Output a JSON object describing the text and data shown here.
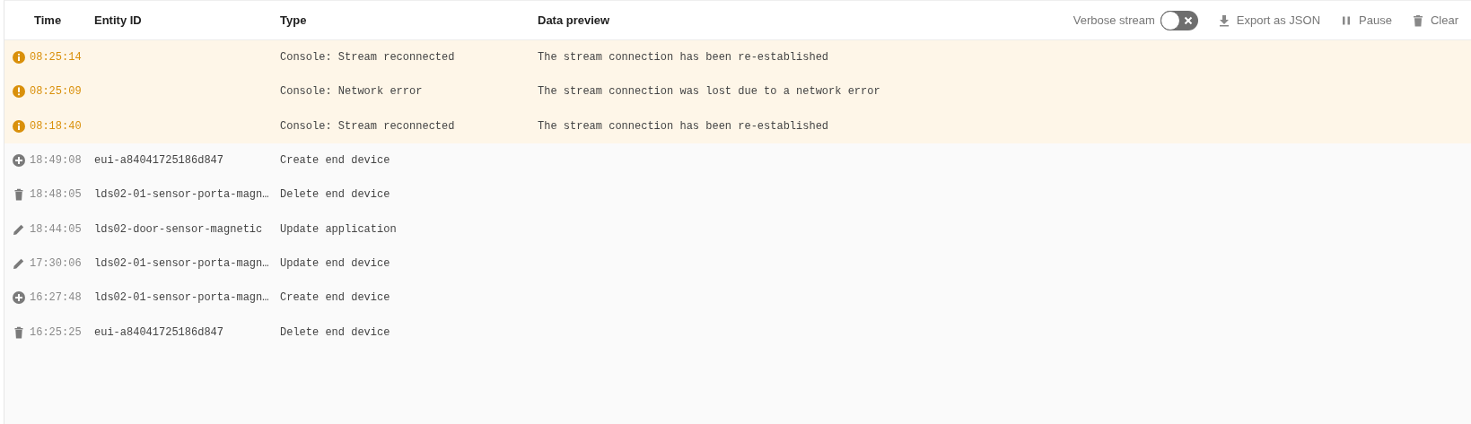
{
  "columns": [
    "Time",
    "Entity ID",
    "Type",
    "Data preview"
  ],
  "toolbar": {
    "verbose": {
      "label": "Verbose stream",
      "on": false
    },
    "buttons": [
      {
        "kind": "export",
        "label": "Export as JSON"
      },
      {
        "kind": "pause",
        "label": "Pause"
      },
      {
        "kind": "clear",
        "label": "Clear"
      }
    ]
  },
  "rows": [
    {
      "kind": "info",
      "time": "08:25:14",
      "type": "Console: Stream reconnected",
      "preview": "The stream connection has been re-established"
    },
    {
      "kind": "warning",
      "time": "08:25:09",
      "type": "Console: Network error",
      "preview": "The stream connection was lost due to a network error"
    },
    {
      "kind": "info",
      "time": "08:18:40",
      "type": "Console: Stream reconnected",
      "preview": "The stream connection has been re-established"
    },
    {
      "kind": "create",
      "time": "18:49:08",
      "entity": "eui-a84041725186d847",
      "type": "Create end device"
    },
    {
      "kind": "delete",
      "time": "18:48:05",
      "entity": "lds02-01-sensor-porta-magn…",
      "type": "Delete end device"
    },
    {
      "kind": "update",
      "time": "18:44:05",
      "entity": "lds02-door-sensor-magnetic",
      "type": "Update application"
    },
    {
      "kind": "update",
      "time": "17:30:06",
      "entity": "lds02-01-sensor-porta-magn…",
      "type": "Update end device"
    },
    {
      "kind": "create",
      "time": "16:27:48",
      "entity": "lds02-01-sensor-porta-magn…",
      "type": "Create end device"
    },
    {
      "kind": "delete",
      "time": "16:25:25",
      "entity": "eui-a84041725186d847",
      "type": "Delete end device"
    }
  ]
}
